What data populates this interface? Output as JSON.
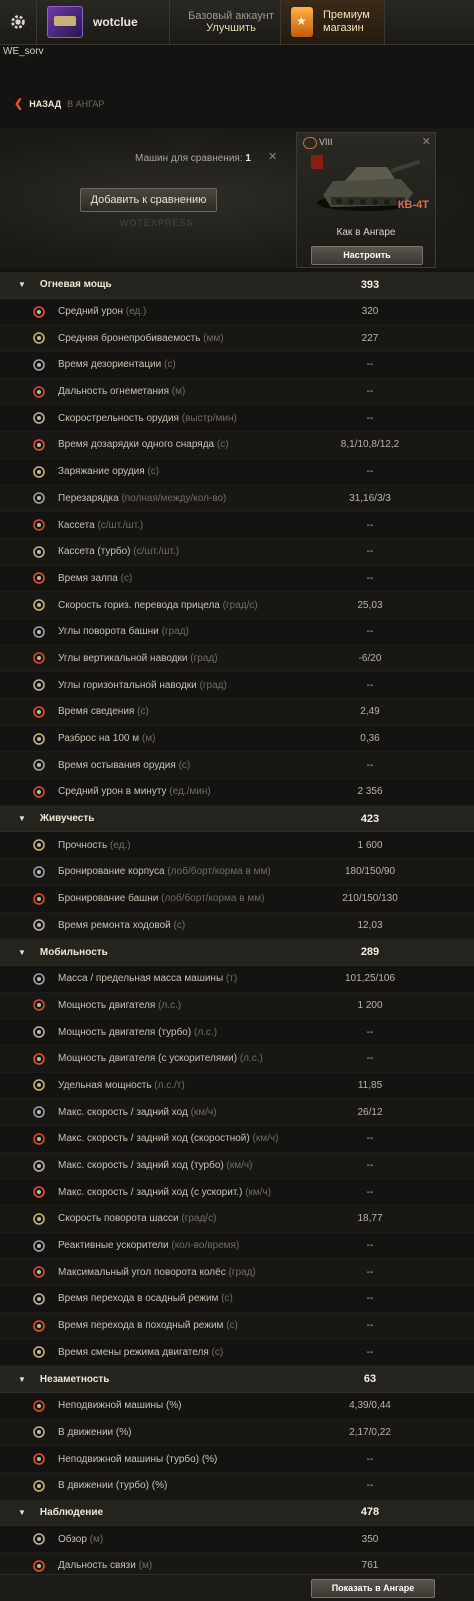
{
  "header": {
    "nickname": "wotclue",
    "account_line1": "Базовый аккаунт",
    "account_line2": "Улучшить",
    "premium_line1": "Премиум",
    "premium_line2": "магазин",
    "server": "WE_sorv"
  },
  "nav": {
    "back_label": "НАЗАД",
    "back_target": "В АНГАР"
  },
  "compare": {
    "count_label": "Машин для сравнения:",
    "count": "1",
    "add_button": "Добавить к сравнению",
    "watermark": "WOTEXPRESS"
  },
  "vehicle": {
    "tier": "VIII",
    "name": "КВ-4Т",
    "hangar_label": "Как в Ангаре",
    "setup_button": "Настроить"
  },
  "colors": {
    "accent": "#e0502d",
    "tank_name": "#e56b47",
    "bg": "#141311"
  },
  "categories": [
    {
      "name": "Огневая мощь",
      "value": "393",
      "rows": [
        {
          "label": "Средний урон",
          "unit": "(ед.)",
          "value": "320",
          "icon": "damage-icon"
        },
        {
          "label": "Средняя бронепробиваемость",
          "unit": "(мм)",
          "value": "227",
          "icon": "penetration-icon"
        },
        {
          "label": "Время дезориентации",
          "unit": "(с)",
          "value": "--",
          "icon": "stun-icon"
        },
        {
          "label": "Дальность огнеметания",
          "unit": "(м)",
          "value": "--",
          "icon": "flame-range-icon"
        },
        {
          "label": "Скорострельность орудия",
          "unit": "(выстр/мин)",
          "value": "--",
          "icon": "rate-of-fire-icon"
        },
        {
          "label": "Время дозарядки одного снаряда",
          "unit": "(с)",
          "value": "8,1/10,8/12,2",
          "icon": "reload-shell-icon"
        },
        {
          "label": "Заряжание орудия",
          "unit": "(с)",
          "value": "--",
          "icon": "loading-icon"
        },
        {
          "label": "Перезарядка",
          "unit": "(полная/между/кол-во)",
          "value": "31,16/3/3",
          "icon": "autoloader-icon"
        },
        {
          "label": "Кассета",
          "unit": "(с/шт./шт.)",
          "value": "--",
          "icon": "clip-icon"
        },
        {
          "label": "Кассета (турбо)",
          "unit": "(с/шт./шт.)",
          "value": "--",
          "icon": "clip-turbo-icon"
        },
        {
          "label": "Время залпа",
          "unit": "(с)",
          "value": "--",
          "icon": "salvo-icon"
        },
        {
          "label": "Скорость гориз. перевода прицела",
          "unit": "(град/с)",
          "value": "25,03",
          "icon": "traverse-icon"
        },
        {
          "label": "Углы поворота башни",
          "unit": "(град)",
          "value": "--",
          "icon": "turret-angle-icon"
        },
        {
          "label": "Углы вертикальной наводки",
          "unit": "(град)",
          "value": "-6/20",
          "icon": "elevation-icon"
        },
        {
          "label": "Углы горизонтальной наводки",
          "unit": "(град)",
          "value": "--",
          "icon": "horizontal-aim-icon"
        },
        {
          "label": "Время сведения",
          "unit": "(с)",
          "value": "2,49",
          "icon": "aim-time-icon"
        },
        {
          "label": "Разброс на 100 м",
          "unit": "(м)",
          "value": "0,36",
          "icon": "dispersion-icon"
        },
        {
          "label": "Время остывания орудия",
          "unit": "(с)",
          "value": "--",
          "icon": "cooling-icon"
        },
        {
          "label": "Средний урон в минуту",
          "unit": "(ед./мин)",
          "value": "2 356",
          "icon": "dpm-icon"
        }
      ]
    },
    {
      "name": "Живучесть",
      "value": "423",
      "rows": [
        {
          "label": "Прочность",
          "unit": "(ед.)",
          "value": "1 600",
          "icon": "hitpoints-icon"
        },
        {
          "label": "Бронирование корпуса",
          "unit": "(лоб/борт/корма в мм)",
          "value": "180/150/90",
          "icon": "hull-armor-icon"
        },
        {
          "label": "Бронирование башни",
          "unit": "(лоб/борт/корма в мм)",
          "value": "210/150/130",
          "icon": "turret-armor-icon"
        },
        {
          "label": "Время ремонта ходовой",
          "unit": "(с)",
          "value": "12,03",
          "icon": "repair-icon"
        }
      ]
    },
    {
      "name": "Мобильность",
      "value": "289",
      "rows": [
        {
          "label": "Масса / предельная масса машины",
          "unit": "(т)",
          "value": "101,25/106",
          "icon": "weight-icon"
        },
        {
          "label": "Мощность двигателя",
          "unit": "(л.с.)",
          "value": "1 200",
          "icon": "engine-icon"
        },
        {
          "label": "Мощность двигателя (турбо)",
          "unit": "(л.с.)",
          "value": "--",
          "icon": "engine-turbo-icon"
        },
        {
          "label": "Мощность двигателя (с ускорителями)",
          "unit": "(л.с.)",
          "value": "--",
          "icon": "engine-boost-icon"
        },
        {
          "label": "Удельная мощность",
          "unit": "(л.с./т)",
          "value": "11,85",
          "icon": "specific-power-icon"
        },
        {
          "label": "Макс. скорость / задний ход",
          "unit": "(км/ч)",
          "value": "26/12",
          "icon": "speed-icon"
        },
        {
          "label": "Макс. скорость / задний ход (скоростной)",
          "unit": "(км/ч)",
          "value": "--",
          "icon": "speed-fast-icon"
        },
        {
          "label": "Макс. скорость / задний ход (турбо)",
          "unit": "(км/ч)",
          "value": "--",
          "icon": "speed-turbo-icon"
        },
        {
          "label": "Макс. скорость / задний ход (с ускорит.)",
          "unit": "(км/ч)",
          "value": "--",
          "icon": "speed-boost-icon"
        },
        {
          "label": "Скорость поворота шасси",
          "unit": "(град/с)",
          "value": "18,77",
          "icon": "hull-traverse-icon"
        },
        {
          "label": "Реактивные ускорители",
          "unit": "(кол-во/время)",
          "value": "--",
          "icon": "rocket-boost-icon"
        },
        {
          "label": "Максимальный угол поворота колёс",
          "unit": "(град)",
          "value": "--",
          "icon": "wheel-angle-icon"
        },
        {
          "label": "Время перехода в осадный режим",
          "unit": "(с)",
          "value": "--",
          "icon": "siege-mode-icon"
        },
        {
          "label": "Время перехода в походный режим",
          "unit": "(с)",
          "value": "--",
          "icon": "travel-mode-icon"
        },
        {
          "label": "Время смены режима двигателя",
          "unit": "(с)",
          "value": "--",
          "icon": "engine-mode-icon"
        }
      ]
    },
    {
      "name": "Незаметность",
      "value": "63",
      "rows": [
        {
          "label": "Неподвижной машины (%)",
          "unit": "",
          "value": "4,39/0,44",
          "icon": "camo-stationary-icon"
        },
        {
          "label": "В движении (%)",
          "unit": "",
          "value": "2,17/0,22",
          "icon": "camo-moving-icon"
        },
        {
          "label": "Неподвижной машины (турбо) (%)",
          "unit": "",
          "value": "--",
          "icon": "camo-stationary-turbo-icon"
        },
        {
          "label": "В движении (турбо) (%)",
          "unit": "",
          "value": "--",
          "icon": "camo-moving-turbo-icon"
        }
      ]
    },
    {
      "name": "Наблюдение",
      "value": "478",
      "rows": [
        {
          "label": "Обзор",
          "unit": "(м)",
          "value": "350",
          "icon": "view-range-icon"
        },
        {
          "label": "Дальность связи",
          "unit": "(м)",
          "value": "761",
          "icon": "radio-range-icon"
        }
      ]
    }
  ],
  "footer": {
    "show_button": "Показать в Ангаре"
  }
}
